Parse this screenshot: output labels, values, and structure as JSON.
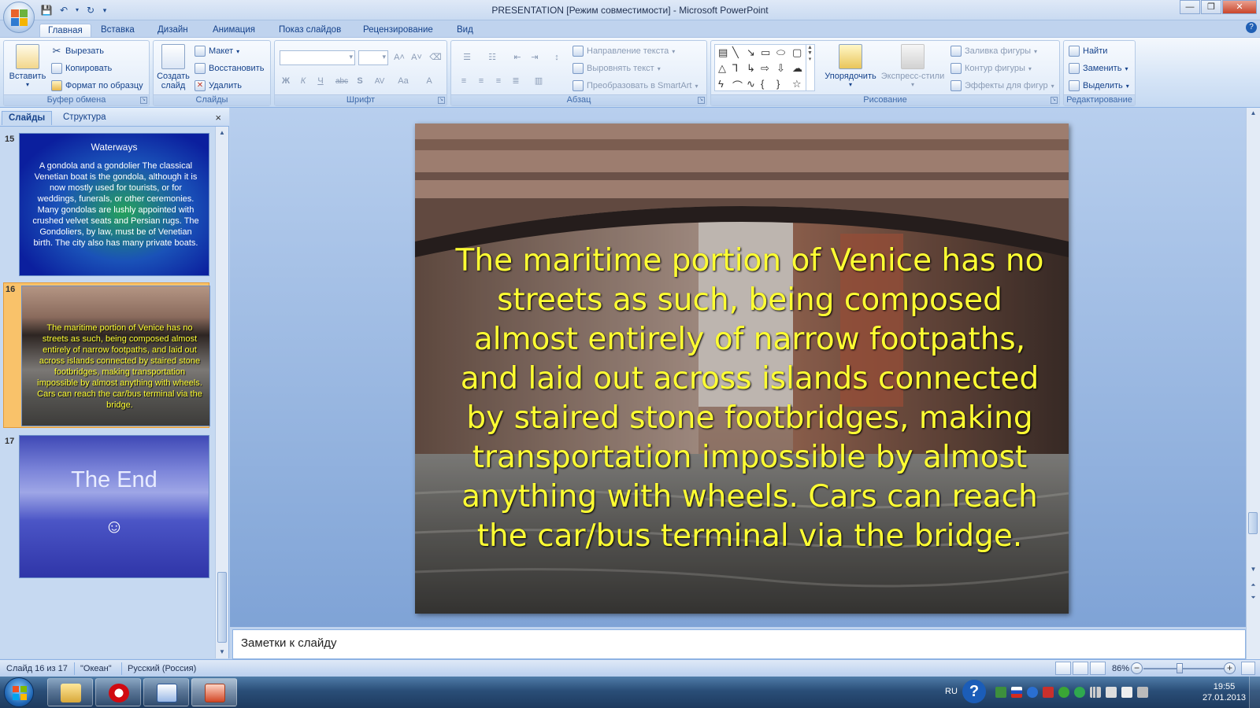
{
  "window": {
    "title": "PRESENTATION [Режим совместимости] - Microsoft PowerPoint"
  },
  "tabs": [
    "Главная",
    "Вставка",
    "Дизайн",
    "Анимация",
    "Показ слайдов",
    "Рецензирование",
    "Вид"
  ],
  "ribbon": {
    "clipboard": {
      "label": "Буфер обмена",
      "paste": "Вставить",
      "cut": "Вырезать",
      "copy": "Копировать",
      "format_painter": "Формат по образцу"
    },
    "slides": {
      "label": "Слайды",
      "new_slide": "Создать слайд",
      "layout": "Макет",
      "reset": "Восстановить",
      "delete": "Удалить"
    },
    "font": {
      "label": "Шрифт",
      "bold": "Ж",
      "italic": "К",
      "underline": "Ч",
      "strike": "abc",
      "shadow": "S",
      "spacing": "AV",
      "case": "Aa",
      "grow": "A",
      "shrink": "A",
      "color": "A"
    },
    "paragraph": {
      "label": "Абзац",
      "text_direction": "Направление текста",
      "align_text": "Выровнять текст",
      "smartart": "Преобразовать в SmartArt"
    },
    "drawing": {
      "label": "Рисование",
      "arrange": "Упорядочить",
      "quick_styles": "Экспресс-стили",
      "shape_fill": "Заливка фигуры",
      "shape_outline": "Контур фигуры",
      "shape_effects": "Эффекты для фигур"
    },
    "editing": {
      "label": "Редактирование",
      "find": "Найти",
      "replace": "Заменить",
      "select": "Выделить"
    }
  },
  "left_pane": {
    "tab_slides": "Слайды",
    "tab_outline": "Структура",
    "close": "×",
    "thumbnails": [
      {
        "number": "15",
        "title": "Waterways",
        "body": "A gondola and a gondolier The classical Venetian boat is the gondola, although it is now mostly used for tourists, or for weddings, funerals, or other ceremonies. Many gondolas are lushly appointed with crushed velvet seats and Persian rugs. The Gondoliers, by law, must be of Venetian birth. The city also has many private boats."
      },
      {
        "number": "16",
        "body": "The maritime portion of Venice has no streets as such, being composed almost entirely of narrow footpaths, and laid out across islands connected by staired stone footbridges, making transportation impossible by almost anything with wheels. Cars can reach the car/bus terminal via the bridge."
      },
      {
        "number": "17",
        "title": "The End",
        "body": "☺"
      }
    ]
  },
  "slide": {
    "text": "The maritime portion of Venice has no streets as such, being composed almost entirely of narrow footpaths, and laid out across islands connected by staired stone footbridges, making transportation impossible by almost anything with wheels. Cars can reach the car/bus terminal via the bridge."
  },
  "notes": {
    "placeholder": "Заметки к слайду"
  },
  "status": {
    "slide_info": "Слайд 16 из 17",
    "theme": "\"Океан\"",
    "language": "Русский (Россия)",
    "zoom": "86%",
    "zoom_level": 0.43
  },
  "taskbar": {
    "lang": "RU",
    "time": "19:55",
    "date": "27.01.2013"
  }
}
